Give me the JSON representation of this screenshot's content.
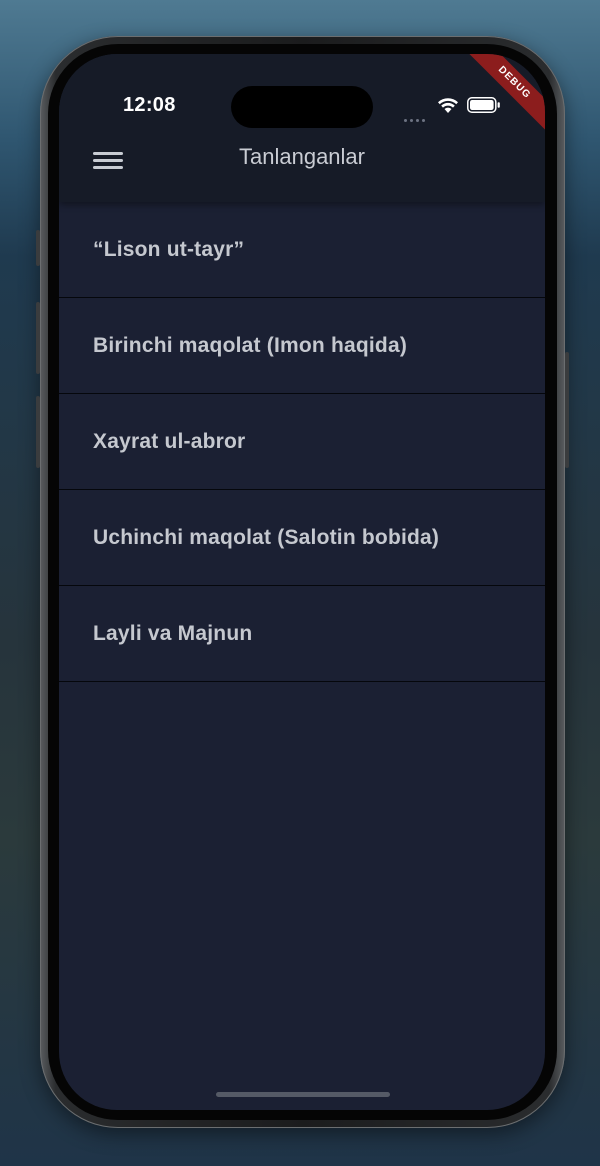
{
  "status_bar": {
    "time": "12:08",
    "debug_banner": "DEBUG"
  },
  "appbar": {
    "title": "Tanlanganlar",
    "menu_icon": "hamburger-menu-icon"
  },
  "favorites": [
    {
      "label": "“Lison ut-tayr”"
    },
    {
      "label": "Birinchi maqolat (Imon haqida)"
    },
    {
      "label": "Xayrat ul-abror"
    },
    {
      "label": "Uchinchi maqolat (Salotin bobida)"
    },
    {
      "label": "Layli va Majnun"
    }
  ],
  "colors": {
    "screen_background": "#1b2033",
    "appbar_background": "#161b27",
    "text": "#c5c8cf",
    "debug_banner": "#8c1d1d"
  }
}
